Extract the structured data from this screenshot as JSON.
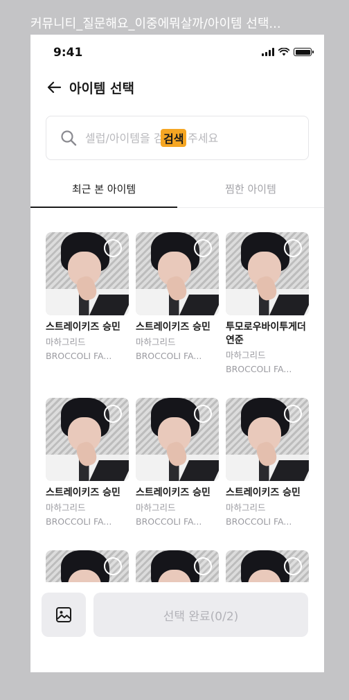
{
  "frame_title": "커뮤니티_질문해요_이중에뭐살까/아이템 선택...",
  "status_bar": {
    "time": "9:41",
    "signal_icon": "cellular-signal-icon",
    "wifi_icon": "wifi-icon",
    "battery_icon": "battery-icon"
  },
  "header": {
    "back_icon": "arrow-left-icon",
    "title": "아이템 선택"
  },
  "search": {
    "icon": "search-icon",
    "placeholder": "셀럽/아이템을 검색해 주세요",
    "highlight": "검색"
  },
  "tabs": [
    {
      "label": "최근 본 아이템",
      "active": true
    },
    {
      "label": "찜한 아이템",
      "active": false
    }
  ],
  "items": [
    {
      "name": "스트레이키즈 승민",
      "shop": "마하그리드",
      "brand": "BROCCOLI FA..."
    },
    {
      "name": "스트레이키즈 승민",
      "shop": "마하그리드",
      "brand": "BROCCOLI FA..."
    },
    {
      "name": "투모로우바이투게더 연준",
      "shop": "마하그리드",
      "brand": "BROCCOLI FA..."
    },
    {
      "name": "스트레이키즈 승민",
      "shop": "마하그리드",
      "brand": "BROCCOLI FA..."
    },
    {
      "name": "스트레이키즈 승민",
      "shop": "마하그리드",
      "brand": "BROCCOLI FA..."
    },
    {
      "name": "스트레이키즈 승민",
      "shop": "마하그리드",
      "brand": "BROCCOLI FA..."
    },
    {
      "name": "",
      "shop": "",
      "brand": ""
    },
    {
      "name": "",
      "shop": "",
      "brand": ""
    },
    {
      "name": "",
      "shop": "",
      "brand": ""
    }
  ],
  "bottom": {
    "gallery_icon": "image-icon",
    "done_label": "선택 완료(0/2)"
  },
  "colors": {
    "highlight": "#f5a623",
    "background": "#c4c4c6",
    "disabled_button": "#ececef",
    "disabled_text": "#b2b2b8"
  }
}
